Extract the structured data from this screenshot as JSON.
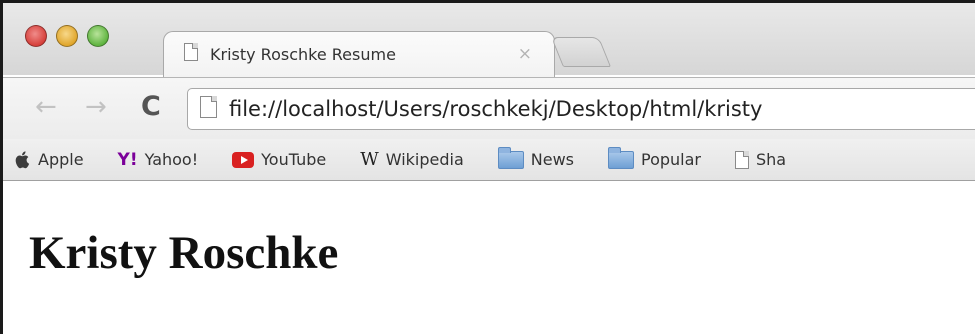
{
  "tab": {
    "title": "Kristy Roschke Resume",
    "close_glyph": "×"
  },
  "toolbar": {
    "back_glyph": "←",
    "forward_glyph": "→",
    "reload_glyph": "C",
    "url": "file://localhost/Users/roschkekj/Desktop/html/kristy"
  },
  "bookmarks": [
    {
      "label": "Apple",
      "icon": "apple-icon",
      "glyph": ""
    },
    {
      "label": "Yahoo!",
      "icon": "yahoo-icon",
      "glyph": "Y!"
    },
    {
      "label": "YouTube",
      "icon": "youtube-icon",
      "glyph": ""
    },
    {
      "label": "Wikipedia",
      "icon": "wikipedia-icon",
      "glyph": "W"
    },
    {
      "label": "News",
      "icon": "folder-icon",
      "glyph": ""
    },
    {
      "label": "Popular",
      "icon": "folder-icon",
      "glyph": ""
    },
    {
      "label": "Sha",
      "icon": "page-icon",
      "glyph": ""
    }
  ],
  "page": {
    "heading": "Kristy Roschke"
  },
  "colors": {
    "close": "#d6403b",
    "minimize": "#e0a62c",
    "zoom": "#5fb440",
    "youtube": "#d92121",
    "yahoo": "#7b0099"
  }
}
